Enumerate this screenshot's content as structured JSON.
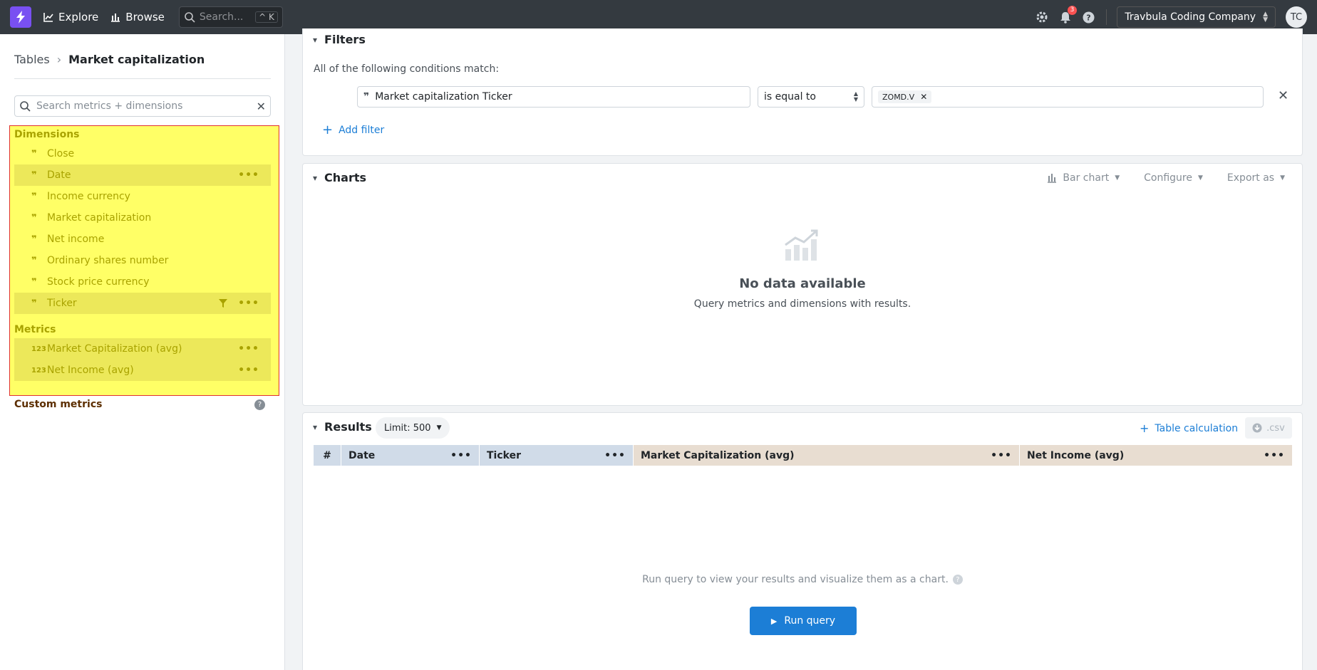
{
  "nav": {
    "explore": "Explore",
    "browse": "Browse",
    "search_placeholder": "Search...",
    "shortcut": "^ K",
    "notifications_count": "3",
    "org": "Travbula Coding Company",
    "avatar": "TC"
  },
  "sidebar": {
    "breadcrumb_root": "Tables",
    "breadcrumb_current": "Market capitalization",
    "search_placeholder": "Search metrics + dimensions",
    "dimensions_title": "Dimensions",
    "dimensions": [
      {
        "label": "Close"
      },
      {
        "label": "Date"
      },
      {
        "label": "Income currency"
      },
      {
        "label": "Market capitalization"
      },
      {
        "label": "Net income"
      },
      {
        "label": "Ordinary shares number"
      },
      {
        "label": "Stock price currency"
      },
      {
        "label": "Ticker"
      }
    ],
    "metrics_title": "Metrics",
    "metrics": [
      {
        "label": "Market Capitalization (avg)"
      },
      {
        "label": "Net Income (avg)"
      }
    ],
    "metric_icon_text": "123",
    "custom_metrics": "Custom metrics"
  },
  "filters": {
    "title": "Filters",
    "condition_text": "All of the following conditions match:",
    "field": "Market capitalization Ticker",
    "operator": "is equal to",
    "value_chip": "ZOMD.V",
    "add_filter": "Add filter"
  },
  "charts": {
    "title": "Charts",
    "chart_type": "Bar chart",
    "configure": "Configure",
    "export": "Export as",
    "empty_title": "No data available",
    "empty_sub": "Query metrics and dimensions with results."
  },
  "results": {
    "title": "Results",
    "limit": "Limit: 500",
    "table_calc": "Table calculation",
    "csv": ".csv",
    "columns": [
      "#",
      "Date",
      "Ticker",
      "Market Capitalization (avg)",
      "Net Income (avg)"
    ],
    "run_hint": "Run query to view your results and visualize them as a chart.",
    "run_button": "Run query"
  },
  "colors": {
    "nav_bg": "#343a40",
    "logo": "#7950f2",
    "highlight": "#ffff66",
    "highlight_border": "#e03131",
    "primary": "#1c7ed6"
  }
}
